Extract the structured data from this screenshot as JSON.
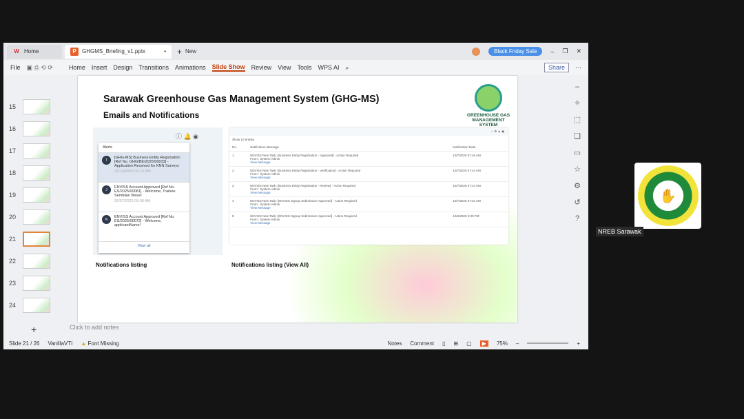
{
  "tabs": {
    "home": "Home",
    "doc": "GHGMS_Briefing_v1.pptx",
    "new": "New",
    "promo": "Black Friday Sale"
  },
  "menu": [
    "File",
    "Home",
    "Insert",
    "Design",
    "Transitions",
    "Animations",
    "Slide Show",
    "Review",
    "View",
    "Tools",
    "WPS AI"
  ],
  "share": "Share",
  "thumbnails": [
    "15",
    "16",
    "17",
    "18",
    "19",
    "20",
    "21",
    "22",
    "23",
    "24"
  ],
  "selected_slide": "21",
  "slide": {
    "title": "Sarawak Greenhouse Gas Management System (GHG-MS)",
    "subtitle": "Emails and Notifications",
    "logo_text": "GREENHOUSE GAS MANAGEMENT SYSTEM",
    "alerts_header": "Alerts",
    "alerts": [
      {
        "initial": "T",
        "text": "[GHG-MS] Business Entity Registration [Ref No. GHG/BE/2025/00033] - Application Received for KNN Surveys",
        "date": "21/10/2025 02:19 PM"
      },
      {
        "initial": "J",
        "text": "ENVISS Account Approved [Ref No. ES/2025/00081] - Welcome, Trainee Sembilan Belas!",
        "date": "30/07/2025 09:08 AM"
      },
      {
        "initial": "N",
        "text": "ENVISS Account Approved [Ref No. ES/2025/00072] - Welcome, applicantName!",
        "date": ""
      }
    ],
    "view_all": "View all",
    "table": {
      "show": "Show 10 entries",
      "headers": [
        "No.",
        "Notification Message",
        "Notification Date"
      ],
      "from": "From : System Admin",
      "view": "View Message",
      "rows": [
        {
          "no": "1",
          "msg": "ENVISS New Task: [Business Entity Registration - Approved] - Action Required",
          "date": "10/7/2025 07:45 AM"
        },
        {
          "no": "2",
          "msg": "ENVISS New Task: [Business Entity Registration - Verification] - Action Required",
          "date": "10/7/2025 07:44 AM"
        },
        {
          "no": "3",
          "msg": "ENVISS New Task: [Business Entity Registration - Review] - Action Required",
          "date": "10/7/2025 07:44 AM"
        },
        {
          "no": "4",
          "msg": "ENVISS New Task: [ENVISS Signup Submission Approved] - Action Required",
          "date": "10/7/2025 07:34 AM"
        },
        {
          "no": "5",
          "msg": "ENVISS New Task: [ENVISS Signup Submission Approved] - Action Required",
          "date": "10/6/2025 3:30 PM"
        }
      ]
    },
    "caption_left": "Notifications listing",
    "caption_right": "Notifications listing (View All)"
  },
  "notes_placeholder": "Click to add notes",
  "status": {
    "slide": "Slide 21 / 26",
    "theme": "VanillaVTI",
    "font": "Font Missing",
    "notes": "Notes",
    "comment": "Comment",
    "zoom": "75%"
  },
  "participant": "NREB Sarawak"
}
